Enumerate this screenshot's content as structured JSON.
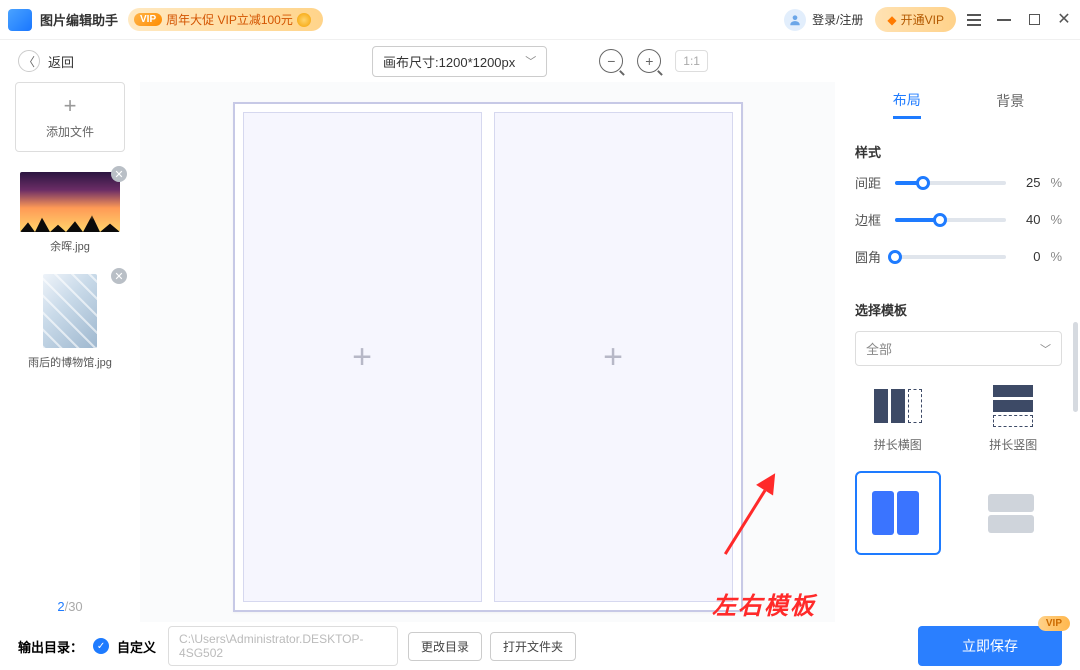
{
  "titlebar": {
    "app_name": "图片编辑助手",
    "promo_vip": "VIP",
    "promo_text": "周年大促 VIP立减100元",
    "login": "登录/注册",
    "open_vip": "开通VIP"
  },
  "toolbar": {
    "back": "返回",
    "canvas_size_label": "画布尺寸:1200*1200px",
    "ratio": "1:1"
  },
  "files": {
    "add_label": "添加文件",
    "items": [
      {
        "name": "余晖.jpg"
      },
      {
        "name": "雨后的博物馆.jpg"
      }
    ],
    "page_current": "2",
    "page_total": "/30"
  },
  "right": {
    "tab_layout": "布局",
    "tab_bg": "背景",
    "style_title": "样式",
    "sliders": {
      "spacing": {
        "label": "间距",
        "value": "25",
        "pct": 25
      },
      "border": {
        "label": "边框",
        "value": "40",
        "pct": 40
      },
      "radius": {
        "label": "圆角",
        "value": "0",
        "pct": 0
      }
    },
    "pct_sign": "%",
    "tmpl_title": "选择模板",
    "tmpl_filter": "全部",
    "tmpl_labels": {
      "long_h": "拼长横图",
      "long_v": "拼长竖图"
    }
  },
  "annotation": "左右模板",
  "bottom": {
    "out_label": "输出目录：",
    "custom": "自定义",
    "path": "C:\\Users\\Administrator.DESKTOP-4SG502",
    "change_dir": "更改目录",
    "open_dir": "打开文件夹",
    "save": "立即保存",
    "vip": "VIP"
  }
}
